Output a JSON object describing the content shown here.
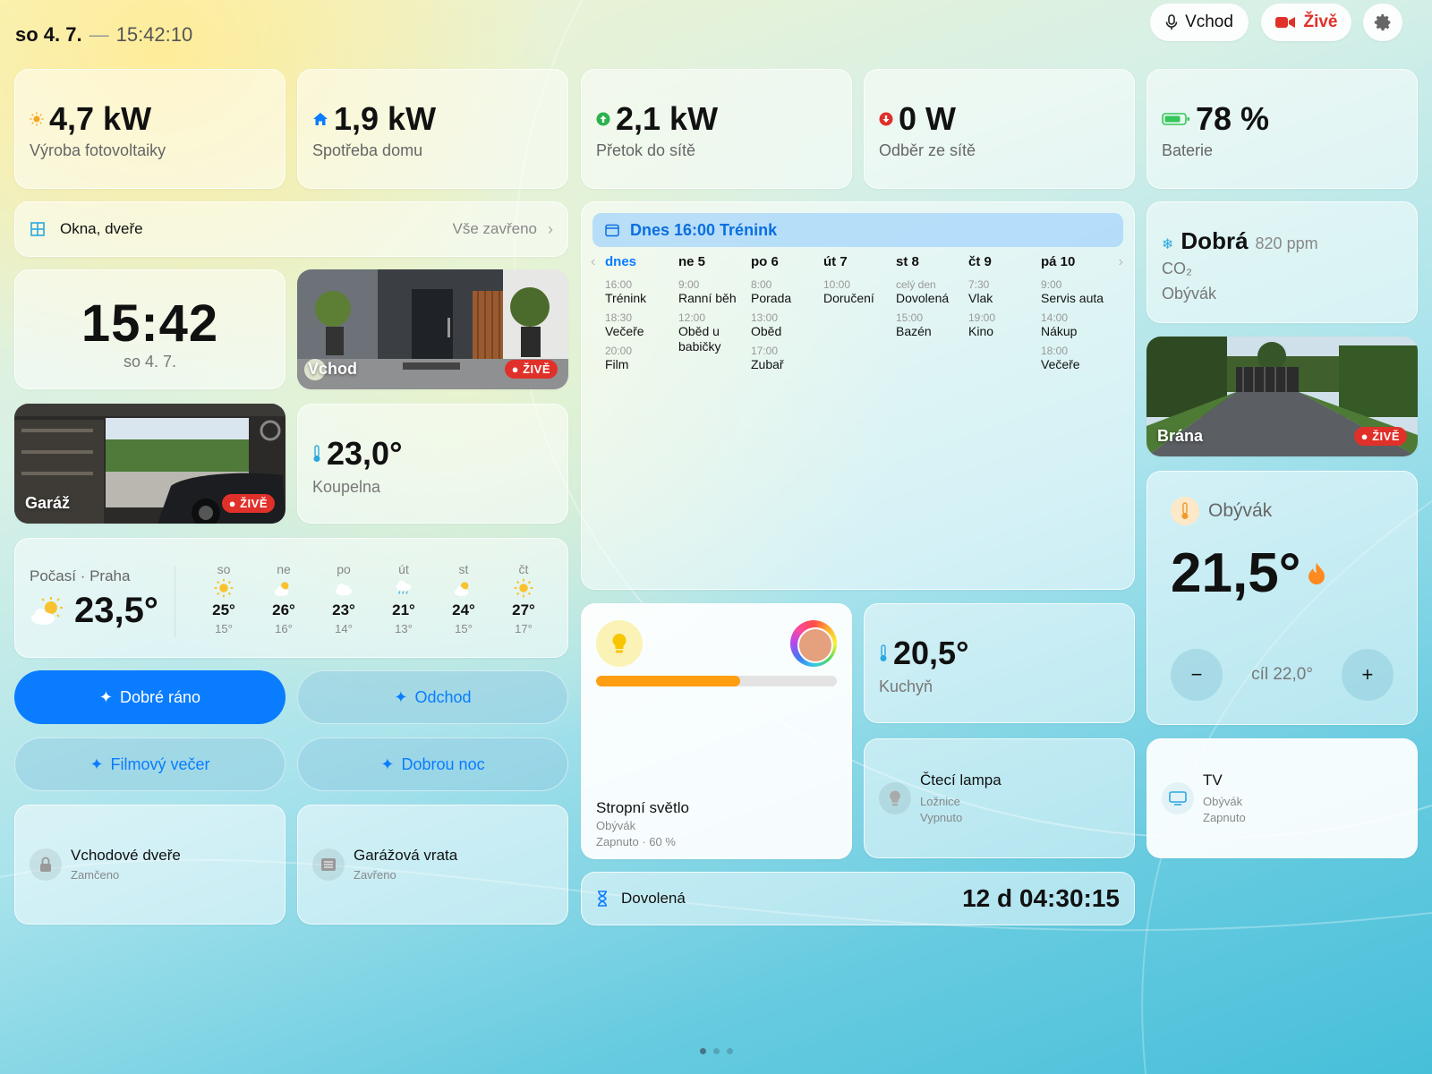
{
  "topbar": {
    "date": "so 4. 7.",
    "separator": "—",
    "time": "15:42:10",
    "camera_button": "Vchod",
    "live_button": "Živě"
  },
  "energy": [
    {
      "value": "4,7 kW",
      "label": "Výroba fotovoltaiky",
      "icon": "sun-icon",
      "color": "#f5a623"
    },
    {
      "value": "1,9 kW",
      "label": "Spotřeba domu",
      "icon": "house-icon",
      "color": "#0a7cff"
    },
    {
      "value": "2,1 kW",
      "label": "Přetok do sítě",
      "icon": "arrow-up-circle-icon",
      "color": "#2bb24c"
    },
    {
      "value": "0 W",
      "label": "Odběr ze sítě",
      "icon": "arrow-down-circle-icon",
      "color": "#e0302a"
    },
    {
      "value": "78 %",
      "label": "Baterie",
      "icon": "battery-icon",
      "color": "#34c759"
    }
  ],
  "openings": {
    "label": "Okna, dveře",
    "status": "Vše zavřeno"
  },
  "clock": {
    "time": "15:42",
    "date": "so 4. 7."
  },
  "cameras": {
    "vchod": {
      "name": "Vchod",
      "badge": "● ŽIVĚ"
    },
    "garaz": {
      "name": "Garáž",
      "badge": "● ŽIVĚ"
    },
    "brana": {
      "name": "Brána",
      "badge": "● ŽIVĚ"
    }
  },
  "koupelna": {
    "value": "23,0°",
    "label": "Koupelna"
  },
  "kuchyn": {
    "value": "20,5°",
    "label": "Kuchyň"
  },
  "weather": {
    "label": "Počasí · Praha",
    "current": "23,5°",
    "days": [
      {
        "name": "so",
        "hi": "25°",
        "lo": "15°",
        "icon": "sun-icon"
      },
      {
        "name": "ne",
        "hi": "26°",
        "lo": "16°",
        "icon": "partly-cloudy-icon"
      },
      {
        "name": "po",
        "hi": "23°",
        "lo": "14°",
        "icon": "cloud-icon"
      },
      {
        "name": "út",
        "hi": "21°",
        "lo": "13°",
        "icon": "rain-icon"
      },
      {
        "name": "st",
        "hi": "24°",
        "lo": "15°",
        "icon": "partly-cloudy-icon"
      },
      {
        "name": "čt",
        "hi": "27°",
        "lo": "17°",
        "icon": "sun-icon"
      }
    ]
  },
  "scenes": {
    "morning": "Dobré ráno",
    "leave": "Odchod",
    "movie": "Filmový večer",
    "night": "Dobrou noc"
  },
  "devices": {
    "door": {
      "name": "Vchodové dveře",
      "status": "Zamčeno"
    },
    "garage": {
      "name": "Garážová vrata",
      "status": "Zavřeno"
    },
    "lamp": {
      "name": "Čtecí lampa",
      "room": "Ložnice",
      "status": "Vypnuto"
    },
    "tv": {
      "name": "TV",
      "room": "Obývák",
      "status": "Zapnuto"
    }
  },
  "calendar": {
    "header": "Dnes 16:00 Trénink",
    "days": [
      {
        "name": "dnes",
        "events": [
          {
            "time": "16:00",
            "title": "Trénink"
          },
          {
            "time": "18:30",
            "title": "Večeře"
          },
          {
            "time": "20:00",
            "title": "Film"
          }
        ]
      },
      {
        "name": "ne 5",
        "events": [
          {
            "time": "9:00",
            "title": "Ranní běh"
          },
          {
            "time": "12:00",
            "title": "Oběd u babičky"
          }
        ]
      },
      {
        "name": "po 6",
        "events": [
          {
            "time": "8:00",
            "title": "Porada"
          },
          {
            "time": "13:00",
            "title": "Oběd"
          },
          {
            "time": "17:00",
            "title": "Zubař"
          }
        ]
      },
      {
        "name": "út 7",
        "events": [
          {
            "time": "10:00",
            "title": "Doručení"
          }
        ]
      },
      {
        "name": "st 8",
        "events": [
          {
            "time": "celý den",
            "title": "Dovolená"
          },
          {
            "time": "15:00",
            "title": "Bazén"
          }
        ]
      },
      {
        "name": "čt 9",
        "events": [
          {
            "time": "7:30",
            "title": "Vlak"
          },
          {
            "time": "19:00",
            "title": "Kino"
          }
        ]
      },
      {
        "name": "pá 10",
        "events": [
          {
            "time": "9:00",
            "title": "Servis auta"
          },
          {
            "time": "14:00",
            "title": "Nákup"
          },
          {
            "time": "18:00",
            "title": "Večeře"
          }
        ]
      }
    ]
  },
  "co2": {
    "quality": "Dobrá",
    "ppm": "820 ppm",
    "label": "CO₂",
    "room": "Obývák"
  },
  "thermostat": {
    "room": "Obývák",
    "temp": "21,5°",
    "target": "cíl 22,0°",
    "minus": "−",
    "plus": "+"
  },
  "light": {
    "name": "Stropní světlo",
    "room": "Obývák",
    "status": "Zapnuto · 60 %",
    "brightness": 0.6
  },
  "countdown": {
    "label": "Dovolená",
    "value": "12 d 04:30:15"
  }
}
